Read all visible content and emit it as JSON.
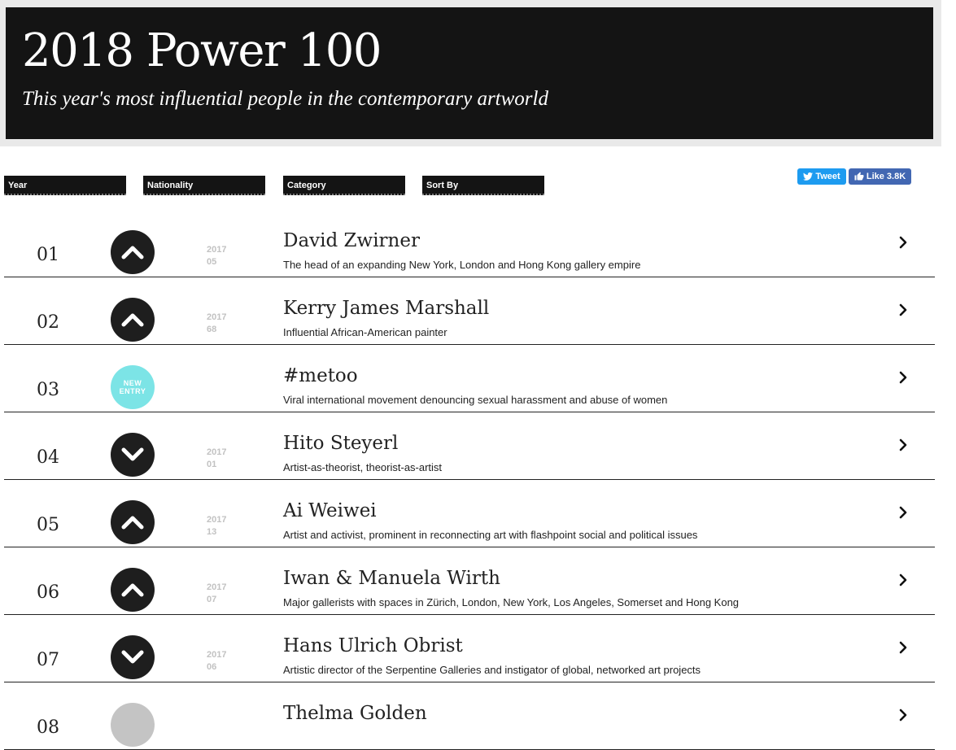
{
  "hero": {
    "title": "2018 Power 100",
    "subtitle": "This year's most influential people in the contemporary artworld"
  },
  "filters": {
    "year": "Year",
    "nationality": "Nationality",
    "category": "Category",
    "sort_by": "Sort By"
  },
  "social": {
    "tweet_label": "Tweet",
    "like_label": "Like 3.8K",
    "tweet_color": "#1d9bf0",
    "like_color": "#4267b2"
  },
  "colors": {
    "new_entry": "#7ce4e6",
    "movement_icon": "#1e1e1e",
    "previous_rank_text": "#c2c2c2"
  },
  "entries": [
    {
      "rank": "01",
      "movement": "up",
      "prev_year": "2017",
      "prev_rank": "05",
      "name": "David Zwirner",
      "description": "The head of an expanding New York, London and Hong Kong gallery empire"
    },
    {
      "rank": "02",
      "movement": "up",
      "prev_year": "2017",
      "prev_rank": "68",
      "name": "Kerry James Marshall",
      "description": "Influential African-American painter"
    },
    {
      "rank": "03",
      "movement": "new",
      "new_label_1": "NEW",
      "new_label_2": "ENTRY",
      "name": "#metoo",
      "description": "Viral international movement denouncing sexual harassment and abuse of women"
    },
    {
      "rank": "04",
      "movement": "down",
      "prev_year": "2017",
      "prev_rank": "01",
      "name": "Hito Steyerl",
      "description": "Artist-as-theorist, theorist-as-artist"
    },
    {
      "rank": "05",
      "movement": "up",
      "prev_year": "2017",
      "prev_rank": "13",
      "name": "Ai Weiwei",
      "description": "Artist and activist, prominent in reconnecting art with flashpoint social and political issues"
    },
    {
      "rank": "06",
      "movement": "up",
      "prev_year": "2017",
      "prev_rank": "07",
      "name": "Iwan & Manuela Wirth",
      "description": "Major gallerists with spaces in Zürich, London, New York, Los Angeles, Somerset and Hong Kong"
    },
    {
      "rank": "07",
      "movement": "down",
      "prev_year": "2017",
      "prev_rank": "06",
      "name": "Hans Ulrich Obrist",
      "description": "Artistic director of the Serpentine Galleries and instigator of global, networked art projects"
    },
    {
      "rank": "08",
      "movement": "same",
      "name": "Thelma Golden"
    }
  ]
}
